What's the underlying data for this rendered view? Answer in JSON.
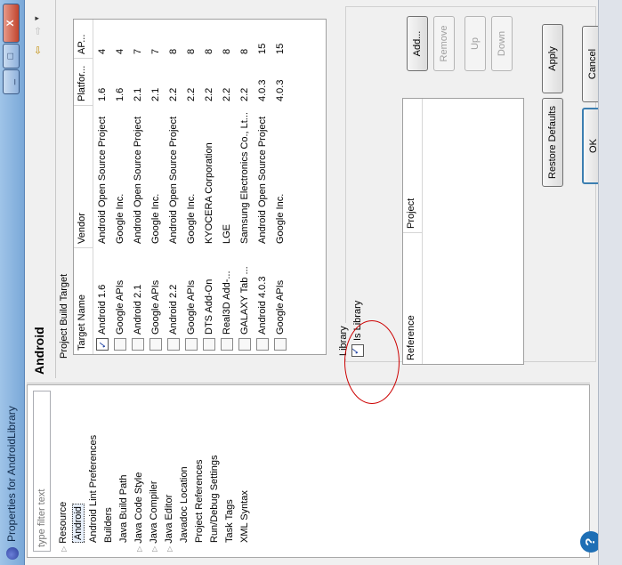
{
  "window": {
    "title": "Properties for AndroidLibrary",
    "close_glyph": "X",
    "max_glyph": "□",
    "min_glyph": "_"
  },
  "sidebar": {
    "filter_placeholder": "type filter text",
    "items": [
      {
        "label": "Resource",
        "arrow": "▷"
      },
      {
        "label": "Android",
        "arrow": ""
      },
      {
        "label": "Android Lint Preferences",
        "arrow": ""
      },
      {
        "label": "Builders",
        "arrow": ""
      },
      {
        "label": "Java Build Path",
        "arrow": ""
      },
      {
        "label": "Java Code Style",
        "arrow": "▷"
      },
      {
        "label": "Java Compiler",
        "arrow": "▷"
      },
      {
        "label": "Java Editor",
        "arrow": "▷"
      },
      {
        "label": "Javadoc Location",
        "arrow": ""
      },
      {
        "label": "Project References",
        "arrow": ""
      },
      {
        "label": "Run/Debug Settings",
        "arrow": ""
      },
      {
        "label": "Task Tags",
        "arrow": ""
      },
      {
        "label": "XML Syntax",
        "arrow": ""
      }
    ],
    "help_glyph": "?"
  },
  "page": {
    "title": "Android",
    "build_target_label": "Project Build Target",
    "columns": [
      "Target Name",
      "Vendor",
      "Platfor...",
      "AP..."
    ],
    "targets": [
      {
        "name": "Android 1.6",
        "vendor": "Android Open Source Project",
        "platform": "1.6",
        "api": "4",
        "checked": true
      },
      {
        "name": "Google APIs",
        "vendor": "Google Inc.",
        "platform": "1.6",
        "api": "4",
        "checked": false
      },
      {
        "name": "Android 2.1",
        "vendor": "Android Open Source Project",
        "platform": "2.1",
        "api": "7",
        "checked": false
      },
      {
        "name": "Google APIs",
        "vendor": "Google Inc.",
        "platform": "2.1",
        "api": "7",
        "checked": false
      },
      {
        "name": "Android 2.2",
        "vendor": "Android Open Source Project",
        "platform": "2.2",
        "api": "8",
        "checked": false
      },
      {
        "name": "Google APIs",
        "vendor": "Google Inc.",
        "platform": "2.2",
        "api": "8",
        "checked": false
      },
      {
        "name": "DTS Add-On",
        "vendor": "KYOCERA Corporation",
        "platform": "2.2",
        "api": "8",
        "checked": false
      },
      {
        "name": "Real3D Add-...",
        "vendor": "LGE",
        "platform": "2.2",
        "api": "8",
        "checked": false
      },
      {
        "name": "GALAXY Tab ...",
        "vendor": "Samsung Electronics Co., Lt...",
        "platform": "2.2",
        "api": "8",
        "checked": false
      },
      {
        "name": "Android 4.0.3",
        "vendor": "Android Open Source Project",
        "platform": "4.0.3",
        "api": "15",
        "checked": false
      },
      {
        "name": "Google APIs",
        "vendor": "Google Inc.",
        "platform": "4.0.3",
        "api": "15",
        "checked": false
      }
    ],
    "library_label": "Library",
    "is_library_label": "Is Library",
    "ref_columns": [
      "Reference",
      "Project"
    ],
    "buttons": {
      "add": "Add...",
      "remove": "Remove",
      "up": "Up",
      "down": "Down",
      "restore_defaults": "Restore Defaults",
      "apply": "Apply",
      "ok": "OK",
      "cancel": "Cancel"
    }
  },
  "colors": {
    "titlebar": "#8fb5e0",
    "annotation_oval": "#cc0000",
    "close_button": "#c1442d"
  }
}
